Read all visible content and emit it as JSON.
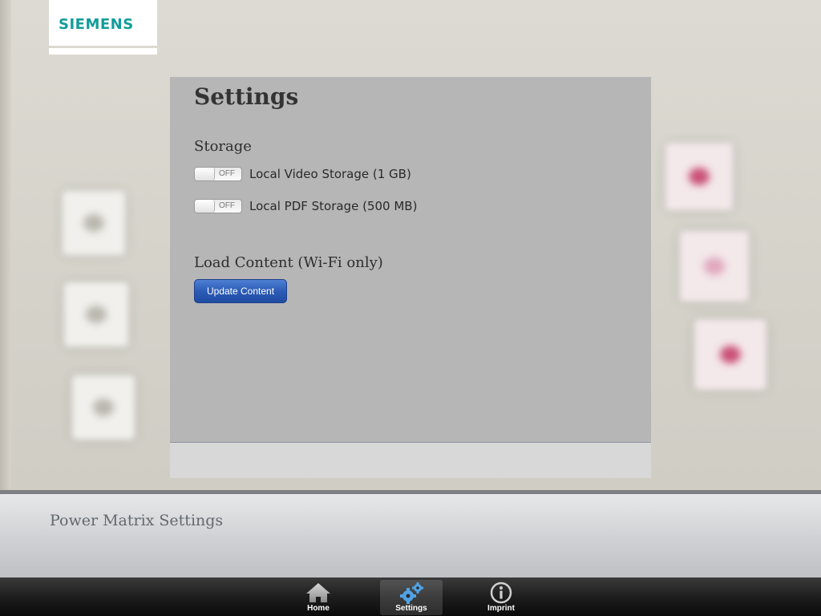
{
  "brand": {
    "logo_text": "SIEMENS",
    "color": "#129c9a"
  },
  "settings": {
    "title": "Settings",
    "storage": {
      "heading": "Storage",
      "toggles": [
        {
          "label": "Local Video Storage (1 GB)",
          "state": "OFF"
        },
        {
          "label": "Local PDF Storage (500 MB)",
          "state": "OFF"
        }
      ]
    },
    "load": {
      "heading": "Load Content (Wi-Fi only)",
      "button_label": "Update Content",
      "button_color": "#2c5cb6"
    }
  },
  "caption": "Power Matrix Settings",
  "tabbar": {
    "tabs": [
      {
        "label": "Home",
        "icon": "home-icon"
      },
      {
        "label": "Settings",
        "icon": "gears-icon",
        "active": true
      },
      {
        "label": "Imprint",
        "icon": "info-icon"
      }
    ]
  }
}
